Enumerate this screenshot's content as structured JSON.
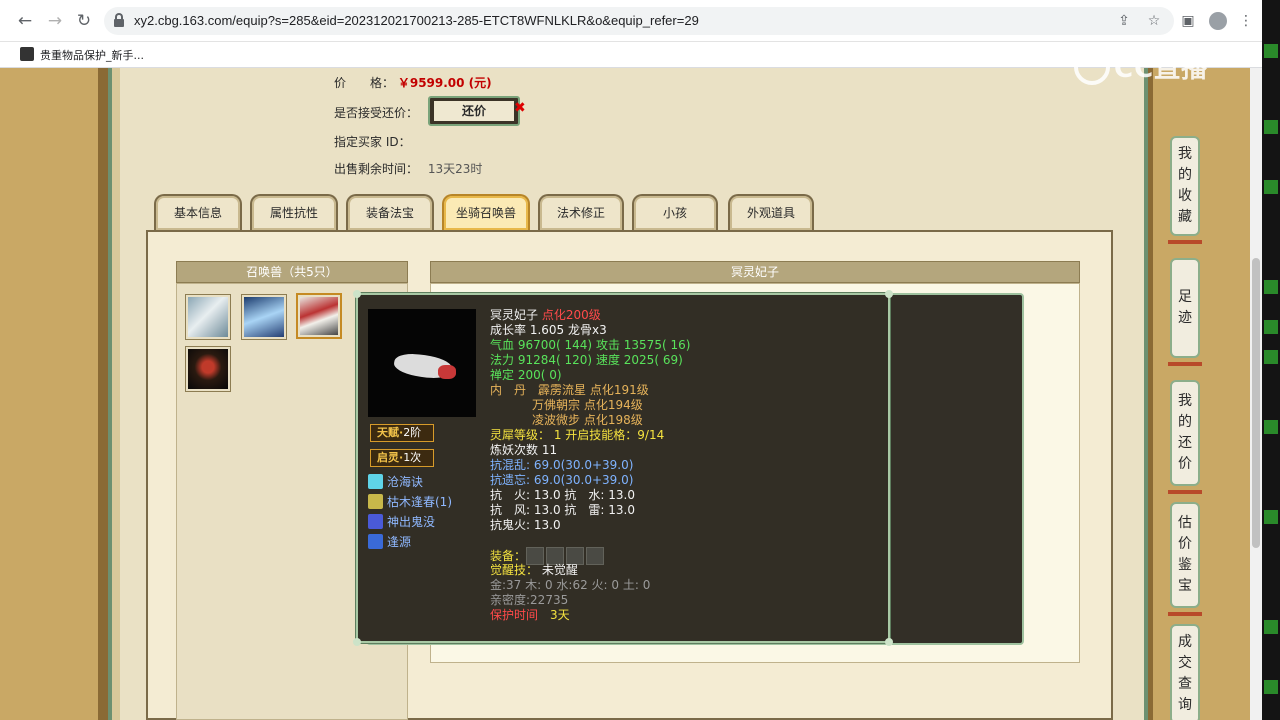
{
  "browser": {
    "url": "xy2.cbg.163.com/equip?s=285&eid=202312021700213-285-ETCT8WFNLKLR&o&equip_refer=29",
    "bookmark": "贵重物品保护_新手..."
  },
  "sale": {
    "price_label": "价　　格：",
    "price_value": "￥9599.00 (元)",
    "counter_label": "是否接受还价：",
    "counter_button": "还价",
    "buyer_label": "指定买家 ID：",
    "time_label": "出售剩余时间：",
    "time_value": "13天23时"
  },
  "tabs": [
    "基本信息",
    "属性抗性",
    "装备法宝",
    "坐骑召唤兽",
    "法术修正",
    "小孩",
    "外观道具"
  ],
  "active_tab": "坐骑召唤兽",
  "pets_panel": {
    "header": "召唤兽（共5只）"
  },
  "detail_panel": {
    "header": "冥灵妃子"
  },
  "tooltip": {
    "name": "冥灵妃子",
    "tier": "点化200级",
    "growth": "成长率 1.605 龙骨x3",
    "hp_label": "气血",
    "hp_value": "96700( 144)",
    "atk_label": "攻击",
    "atk_value": "13575( 16)",
    "mp_label": "法力",
    "mp_value": "91284( 120)",
    "spd_label": "速度",
    "spd_value": "2025( 69)",
    "focus_label": "禅定",
    "focus_value": "200( 0)",
    "dan_label": "内　丹",
    "dan_1": "霹雳流星 点化191级",
    "dan_2": "万佛朝宗 点化194级",
    "dan_3": "凌波微步 点化198级",
    "lingxi_label": "灵犀等级：",
    "lingxi_value": "1 开启技能格：9/14",
    "refine": "炼妖次数 11",
    "res_1": "抗混乱: 69.0(30.0+39.0)",
    "res_2": "抗遗忘: 69.0(30.0+39.0)",
    "res_3": "抗　火: 13.0 抗　水: 13.0",
    "res_4": "抗　风: 13.0 抗　雷: 13.0",
    "res_5": "抗鬼火: 13.0",
    "equip_label": "装备：",
    "awaken_label": "觉醒技：",
    "awaken_value": "未觉醒",
    "elements": "金:37 木: 0 水:62 火: 0 土: 0",
    "intimacy": "亲密度:22735",
    "protect_label": "保护时间",
    "protect_value": "3天",
    "badge_1": "天赋·",
    "badge_1_val": "2阶",
    "badge_2": "启灵·",
    "badge_2_val": "1次",
    "skills": [
      "沧海诀",
      "枯木逢春(1)",
      "神出鬼没",
      "逢源"
    ]
  },
  "side_nav": [
    "我的收藏",
    "足迹",
    "我的还价",
    "估价鉴宝",
    "成交查询"
  ],
  "watermark": "CC直播",
  "colors": {
    "price": "#c20000",
    "tooltip_bg": "#322e25",
    "tooltip_border": "#a9c9a5",
    "active_tab": "#e8b84a"
  }
}
